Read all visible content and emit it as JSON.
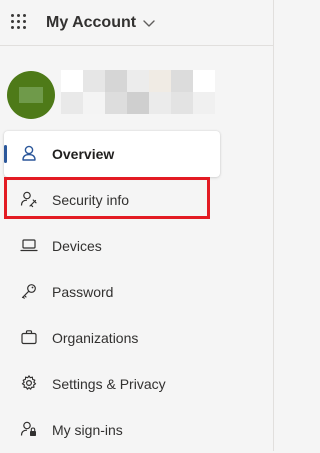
{
  "header": {
    "app_title": "My Account"
  },
  "profile": {
    "avatar_color": "#4e7a18",
    "redaction_colors": [
      [
        "#ffffff",
        "#e6e6e6",
        "#d6d6d6",
        "#ececec",
        "#f0ebe4",
        "#dcdcdc",
        "#ffffff"
      ],
      [
        "#e9e9e9",
        "#f4f4f4",
        "#dddddd",
        "#cfcfcf",
        "#ebebeb",
        "#e3e3e3",
        "#f0f0f0"
      ]
    ]
  },
  "nav": {
    "items": [
      {
        "label": "Overview",
        "icon": "person-icon",
        "selected": true
      },
      {
        "label": "Security info",
        "icon": "person-key-icon",
        "selected": false,
        "highlighted": true
      },
      {
        "label": "Devices",
        "icon": "laptop-icon",
        "selected": false
      },
      {
        "label": "Password",
        "icon": "key-icon",
        "selected": false
      },
      {
        "label": "Organizations",
        "icon": "briefcase-icon",
        "selected": false
      },
      {
        "label": "Settings & Privacy",
        "icon": "gear-icon",
        "selected": false
      },
      {
        "label": "My sign-ins",
        "icon": "person-lock-icon",
        "selected": false
      }
    ]
  },
  "colors": {
    "accent": "#2b579a",
    "highlight": "#e31b23",
    "background": "#f5f5f5"
  }
}
